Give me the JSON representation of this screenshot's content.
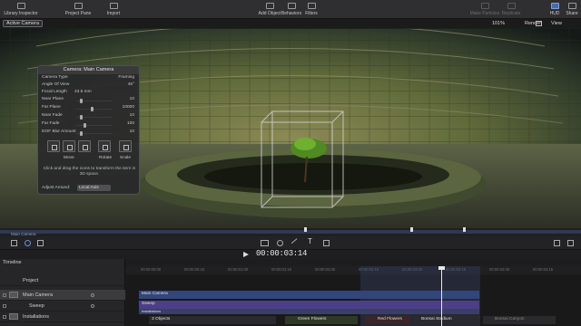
{
  "toolbar": {
    "library_inspector": "Library Inspector",
    "project_pane": "Project Pane",
    "import": "Import",
    "add_object": "Add Object",
    "behaviors": "Behaviors",
    "filters": "Filters",
    "make_particles": "Make Particles",
    "replicate": "Replicate",
    "hud": "HUD",
    "share": "Share"
  },
  "viewer": {
    "active_camera": "Active Camera",
    "zoom": "101%",
    "render": "Render",
    "view": "View"
  },
  "hud": {
    "title": "Camera: Main Camera",
    "rows": [
      {
        "label": "Camera Type",
        "value": "Framing"
      },
      {
        "label": "Angle Of View",
        "value": "45°"
      },
      {
        "label": "Focal Length",
        "value": "43.5 mm"
      },
      {
        "label": "Near Plane",
        "value": "10"
      },
      {
        "label": "Far Plane",
        "value": "10000"
      },
      {
        "label": "Near Fade",
        "value": "10"
      },
      {
        "label": "Far Fade",
        "value": "100"
      },
      {
        "label": "DOF Blur Amount",
        "value": "10"
      }
    ],
    "move_label": "Move",
    "rotate_label": "Rotate",
    "scale_label": "Scale",
    "hint": "Click and drag the icons to transform the item in 3D space.",
    "adjust_label": "Adjust Around:",
    "adjust_value": "Local Axis"
  },
  "mini_timeline": {
    "label": "Main Camera"
  },
  "transport": {
    "timecode": "00:00:03:14"
  },
  "layers": {
    "timeline_label": "Timeline",
    "rows": [
      {
        "name": "Project"
      },
      {
        "name": "Main Camera"
      },
      {
        "name": "Sweep"
      },
      {
        "name": "Installations"
      }
    ]
  },
  "timeline": {
    "ticks": [
      "00:00:00:00",
      "00:00:00:15",
      "00:00:01:00",
      "00:00:01:15",
      "00:00:02:00",
      "00:00:02:15",
      "00:00:03:00",
      "00:00:03:15",
      "00:00:04:00",
      "00:00:04:15"
    ],
    "clips": {
      "main_camera": "Main Camera",
      "sweep": "Sweep",
      "installations": "Installations",
      "objects": "3 Objects",
      "green_flowers": "Green Flowers",
      "red_flowers": "Red Flowers",
      "bonsai_stadium": "Bonsai Stadium",
      "bonsai_canyon": "Bonsai Canyon"
    }
  },
  "colors": {
    "accent": "#4a6aa8",
    "clip_blue": "#32467a",
    "clip_purple": "#4b3f8a"
  }
}
